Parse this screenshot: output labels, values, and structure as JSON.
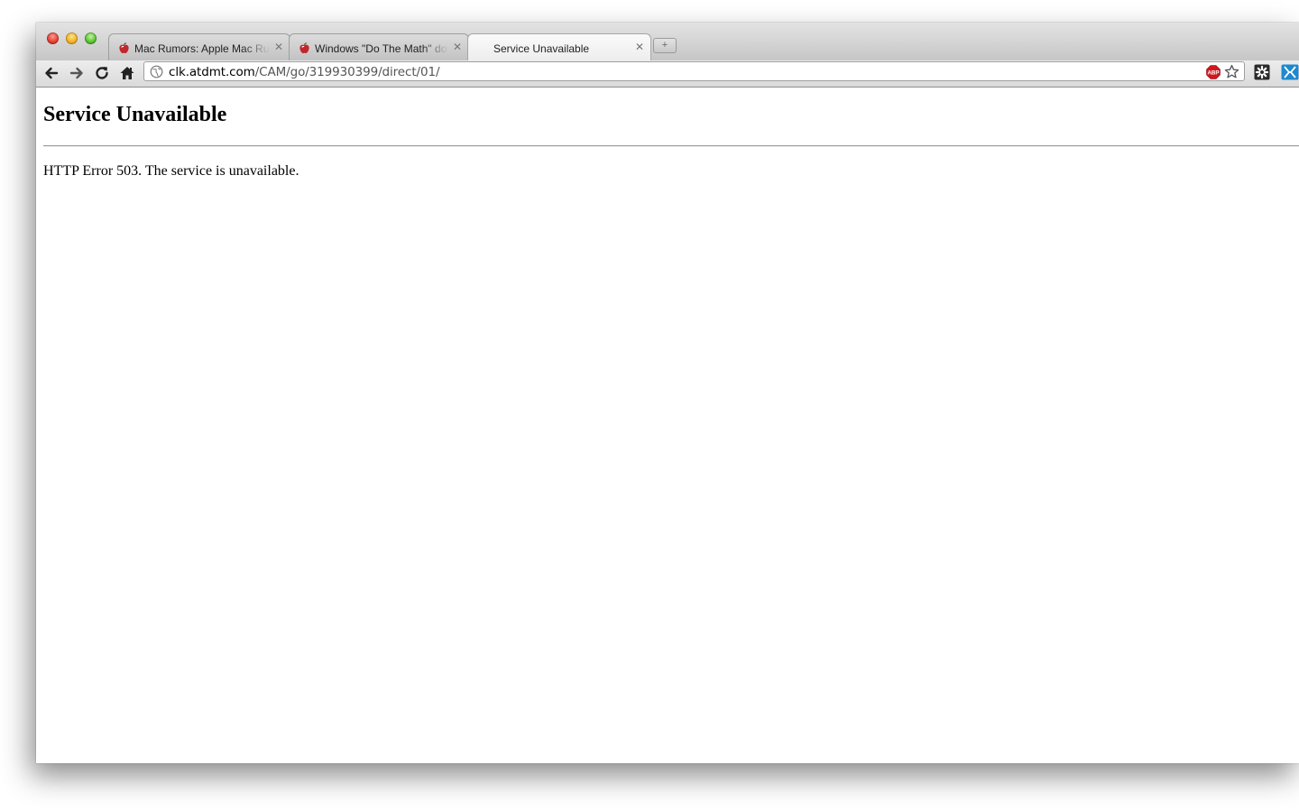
{
  "tabs": [
    {
      "title": "Mac Rumors: Apple Mac Rumors and News You Care About",
      "favicon": "macrumors-apple-icon",
      "active": false
    },
    {
      "title": "Windows \"Do The Math\" download",
      "favicon": "macrumors-apple-icon",
      "active": false
    },
    {
      "title": "Service Unavailable",
      "favicon": "none",
      "active": true
    }
  ],
  "toolbar": {
    "url_host": "clk.atdmt.com",
    "url_path": "/CAM/go/319930399/direct/01/",
    "icons": [
      "back-arrow-icon",
      "forward-arrow-icon",
      "reload-icon",
      "home-icon",
      "globe-icon",
      "adblock-icon",
      "bookmark-star-icon",
      "extension-icon",
      "extension-icon"
    ],
    "adblock_label": "ABP"
  },
  "page": {
    "heading": "Service Unavailable",
    "message": "HTTP Error 503. The service is unavailable."
  },
  "colors": {
    "tab_active": "#f3f3f3",
    "tab_inactive": "#cfcfcf",
    "close_light": "#e0372b",
    "minimize_light": "#f0ad1c",
    "zoom_light": "#4fbf2c",
    "adblock_red": "#d0181e",
    "extension_blue": "#1e88d0"
  }
}
